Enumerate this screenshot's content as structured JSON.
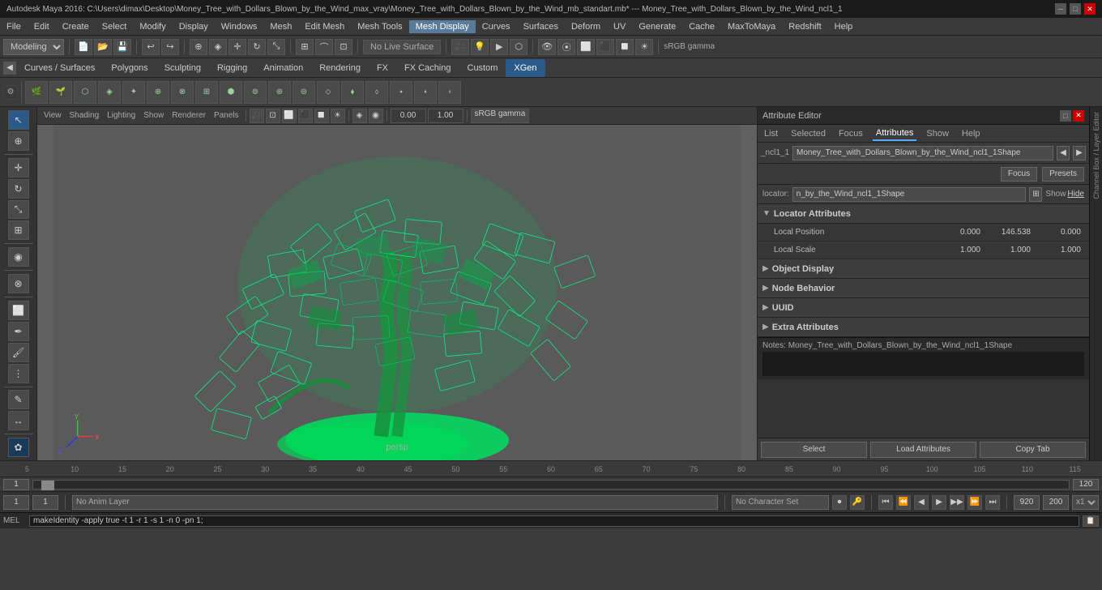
{
  "titlebar": {
    "title": "Autodesk Maya 2016: C:\\Users\\dimax\\Desktop\\Money_Tree_with_Dollars_Blown_by_the_Wind_max_vray\\Money_Tree_with_Dollars_Blown_by_the_Wind_mb_standart.mb* --- Money_Tree_with_Dollars_Blown_by_the_Wind_ncl1_1",
    "minimize": "─",
    "maximize": "□",
    "close": "✕"
  },
  "menubar": {
    "items": [
      "File",
      "Edit",
      "Create",
      "Select",
      "Modify",
      "Display",
      "Windows",
      "Mesh",
      "Edit Mesh",
      "Mesh Tools",
      "Mesh Display",
      "Curves",
      "Surfaces",
      "Deform",
      "UV",
      "Generate",
      "Cache",
      "MaxToMaya",
      "Redshift",
      "Help"
    ]
  },
  "toolbar": {
    "modeling_label": "Modeling",
    "no_live_surface": "No Live Surface",
    "srgb_gamma": "sRGB gamma"
  },
  "shelf_tabs": {
    "items": [
      "Curves / Surfaces",
      "Polygons",
      "Sculpting",
      "Rigging",
      "Animation",
      "Rendering",
      "FX",
      "FX Caching",
      "Custom",
      "XGen"
    ]
  },
  "viewport": {
    "menu_items": [
      "View",
      "Shading",
      "Lighting",
      "Show",
      "Renderer",
      "Panels"
    ],
    "persp_label": "persp",
    "frame_value": "0.00",
    "frame_value2": "1.00"
  },
  "attribute_editor": {
    "title": "Attribute Editor",
    "tabs": [
      "List",
      "Selected",
      "Focus",
      "Attributes",
      "Show",
      "Help"
    ],
    "node_name": "Money_Tree_with_Dollars_Blown_by_the_Wind_ncl1_1Shape",
    "node_short": "_ncl1_1",
    "locator_label": "locator:",
    "locator_value": "n_by_the_Wind_ncl1_1Shape",
    "focus_btn": "Focus",
    "presets_btn": "Presets",
    "show_label": "Show",
    "hide_label": "Hide",
    "sections": {
      "locator": {
        "title": "Locator Attributes",
        "expanded": true,
        "rows": [
          {
            "label": "Local Position",
            "values": [
              "0.000",
              "146.538",
              "0.000"
            ]
          },
          {
            "label": "Local Scale",
            "values": [
              "1.000",
              "1.000",
              "1.000"
            ]
          }
        ]
      },
      "object_display": {
        "title": "Object Display",
        "expanded": false
      },
      "node_behavior": {
        "title": "Node Behavior",
        "expanded": false
      },
      "uuid": {
        "title": "UUID",
        "expanded": false
      },
      "extra_attrs": {
        "title": "Extra Attributes",
        "expanded": false
      }
    },
    "notes_label": "Notes:",
    "notes_node": "Money_Tree_with_Dollars_Blown_by_the_Wind_ncl1_1Shape",
    "footer_btns": [
      "Select",
      "Load Attributes",
      "Copy Tab"
    ]
  },
  "timeline": {
    "ticks": [
      "5",
      "10",
      "15",
      "20",
      "25",
      "30",
      "35",
      "40",
      "45",
      "50",
      "55",
      "60",
      "65",
      "70",
      "75",
      "80",
      "85",
      "90",
      "95",
      "100",
      "105",
      "110",
      "115"
    ],
    "current_frame": "1",
    "end_frame": "120",
    "frame_end2": "920",
    "frame_end3": "200"
  },
  "bottom_bar": {
    "frame1": "1",
    "frame2": "1",
    "anim_layer": "No Anim Layer",
    "char_set": "No Character Set",
    "mel_label": "MEL",
    "command": "makeIdentity -apply true -t 1 -r 1 -s 1 -n 0 -pn 1;"
  },
  "playback": {
    "frame_start": "1",
    "frame_end": "120",
    "playback_frame": "1"
  }
}
